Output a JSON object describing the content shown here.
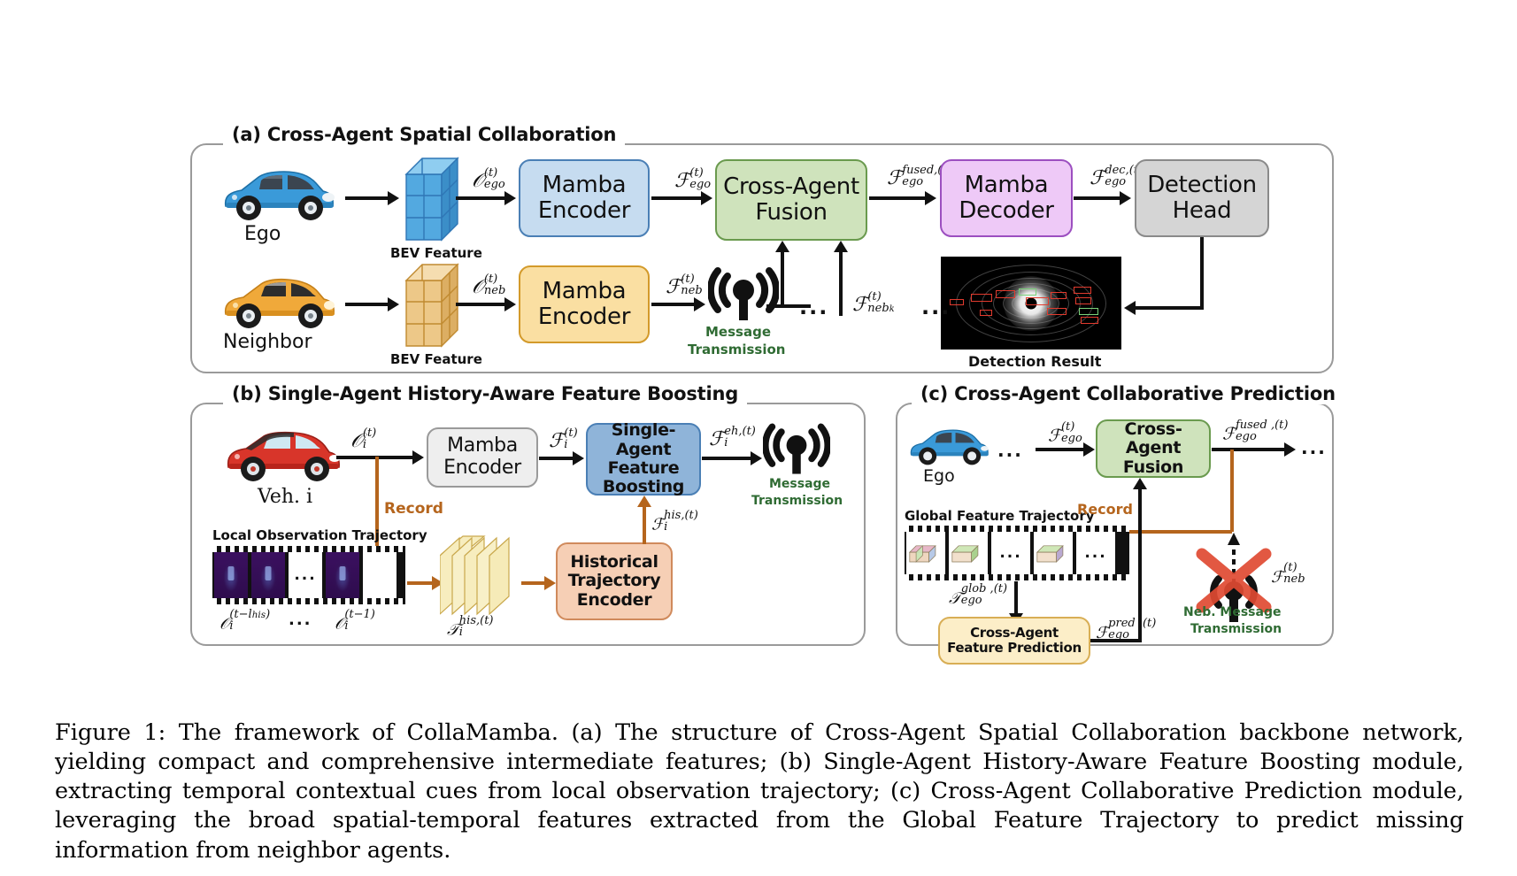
{
  "figure": {
    "caption": "Figure 1: The framework of CollaMamba. (a) The structure of Cross-Agent Spatial Collaboration backbone network, yielding compact and comprehensive intermediate features; (b) Single-Agent History-Aware Feature Boosting module, extracting temporal contextual cues from local observation trajectory; (c) Cross-Agent Collaborative Prediction module, leveraging the broad spatial-temporal features extracted from the Global Feature Trajectory to predict missing information from neighbor agents."
  },
  "panel_a": {
    "title": "(a) Cross-Agent Spatial Collaboration",
    "ego_label": "Ego",
    "neighbor_label": "Neighbor",
    "bev_feature_label_ego": "BEV Feature",
    "bev_feature_label_neb": "BEV Feature",
    "obs_ego": {
      "base": "O",
      "sup": "(t)",
      "sub": "ego"
    },
    "obs_neb": {
      "base": "O",
      "sup": "(t)",
      "sub": "neb"
    },
    "mamba_encoder_ego": "Mamba\nEncoder",
    "mamba_encoder_ego_l1": "Mamba",
    "mamba_encoder_ego_l2": "Encoder",
    "mamba_encoder_neb_l1": "Mamba",
    "mamba_encoder_neb_l2": "Encoder",
    "feat_ego": {
      "base": "F",
      "sup": "(t)",
      "sub": "ego"
    },
    "feat_neb": {
      "base": "F",
      "sup": "(t)",
      "sub": "neb"
    },
    "feat_neb_k": {
      "base": "F",
      "sup": "(t)",
      "sub": "neb_k"
    },
    "cross_agent_fusion_l1": "Cross-Agent",
    "cross_agent_fusion_l2": "Fusion",
    "feat_fused": {
      "base": "F",
      "sup": "fused,(t)",
      "sub": "ego"
    },
    "mamba_decoder_l1": "Mamba",
    "mamba_decoder_l2": "Decoder",
    "feat_dec": {
      "base": "F",
      "sup": "dec,(t)",
      "sub": "ego"
    },
    "detection_head_l1": "Detection",
    "detection_head_l2": "Head",
    "detection_result_label": "Detection Result",
    "message_transmission_l1": "Message",
    "message_transmission_l2": "Transmission",
    "ellipsis_left": "...",
    "ellipsis_right": "..."
  },
  "panel_b": {
    "title": "(b) Single-Agent History-Aware Feature Boosting",
    "vehicle_label": "Veh. i",
    "obs_i": {
      "base": "O",
      "sup": "(t)",
      "sub": "i"
    },
    "mamba_encoder_l1": "Mamba",
    "mamba_encoder_l2": "Encoder",
    "feat_i": {
      "base": "F",
      "sup": "(t)",
      "sub": "i"
    },
    "boosting_l1": "Single-Agent",
    "boosting_l2": "Feature",
    "boosting_l3": "Boosting",
    "feat_eh": {
      "base": "F",
      "sup": "eh,(t)",
      "sub": "i"
    },
    "message_transmission_l1": "Message",
    "message_transmission_l2": "Transmission",
    "record_label": "Record",
    "local_obs_traj_label": "Local Observation Trajectory",
    "obs_first": {
      "base": "O",
      "sup": "(t-l_his)",
      "sub": "i"
    },
    "obs_last": {
      "base": "O",
      "sup": "(t-1)",
      "sub": "i"
    },
    "frames_ellipsis": "...",
    "traj_his": {
      "base": "T",
      "sup": "his,(t)",
      "sub": "i"
    },
    "hist_encoder_l1": "Historical",
    "hist_encoder_l2": "Trajectory",
    "hist_encoder_l3": "Encoder",
    "feat_his": {
      "base": "F",
      "sup": "his,(t)",
      "sub": "i"
    }
  },
  "panel_c": {
    "title": "(c) Cross-Agent Collaborative Prediction",
    "ego_label": "Ego",
    "ellipsis_left": "...",
    "ellipsis_right": "...",
    "feat_ego": {
      "base": "F",
      "sup": "(t)",
      "sub": "ego"
    },
    "cross_agent_fusion_l1": "Cross-Agent",
    "cross_agent_fusion_l2": "Fusion",
    "feat_fused": {
      "base": "F",
      "sup": "fused ,(t)",
      "sub": "ego"
    },
    "global_feature_trajectory_label": "Global Feature Trajectory",
    "record_label": "Record",
    "frames_ellipsis_1": "...",
    "frames_ellipsis_2": "...",
    "traj_glob": {
      "base": "T",
      "sup": "glob ,(t)",
      "sub": "ego"
    },
    "prediction_l1": "Cross-Agent",
    "prediction_l2": "Feature Prediction",
    "feat_pred": {
      "base": "F",
      "sup": "pred ,(t)",
      "sub": "ego"
    },
    "feat_neb": {
      "base": "F",
      "sup": "(t)",
      "sub": "neb"
    },
    "neb_msg_l1": "Neb. Message",
    "neb_msg_l2": "Transmission"
  },
  "colors": {
    "blue_fill": "#c6dcf0",
    "blue_stroke": "#4a7fb5",
    "green_fill": "#cfe3bc",
    "green_stroke": "#6a9a4e",
    "purple_fill": "#eec9f7",
    "purple_stroke": "#9c4fc0",
    "gray_fill": "#d5d5d5",
    "orange_fill": "#fadfa2",
    "orange_stroke": "#d39a2a",
    "peach_fill": "#f6cfb5",
    "cream_fill": "#fceec8",
    "record_brown": "#b5651d",
    "message_green": "#2f6b33",
    "cross_red": "#e04a32",
    "ego_car": "#3a9ad9",
    "neighbor_car": "#f0a93a",
    "vehicle_i_car": "#d8352a"
  }
}
